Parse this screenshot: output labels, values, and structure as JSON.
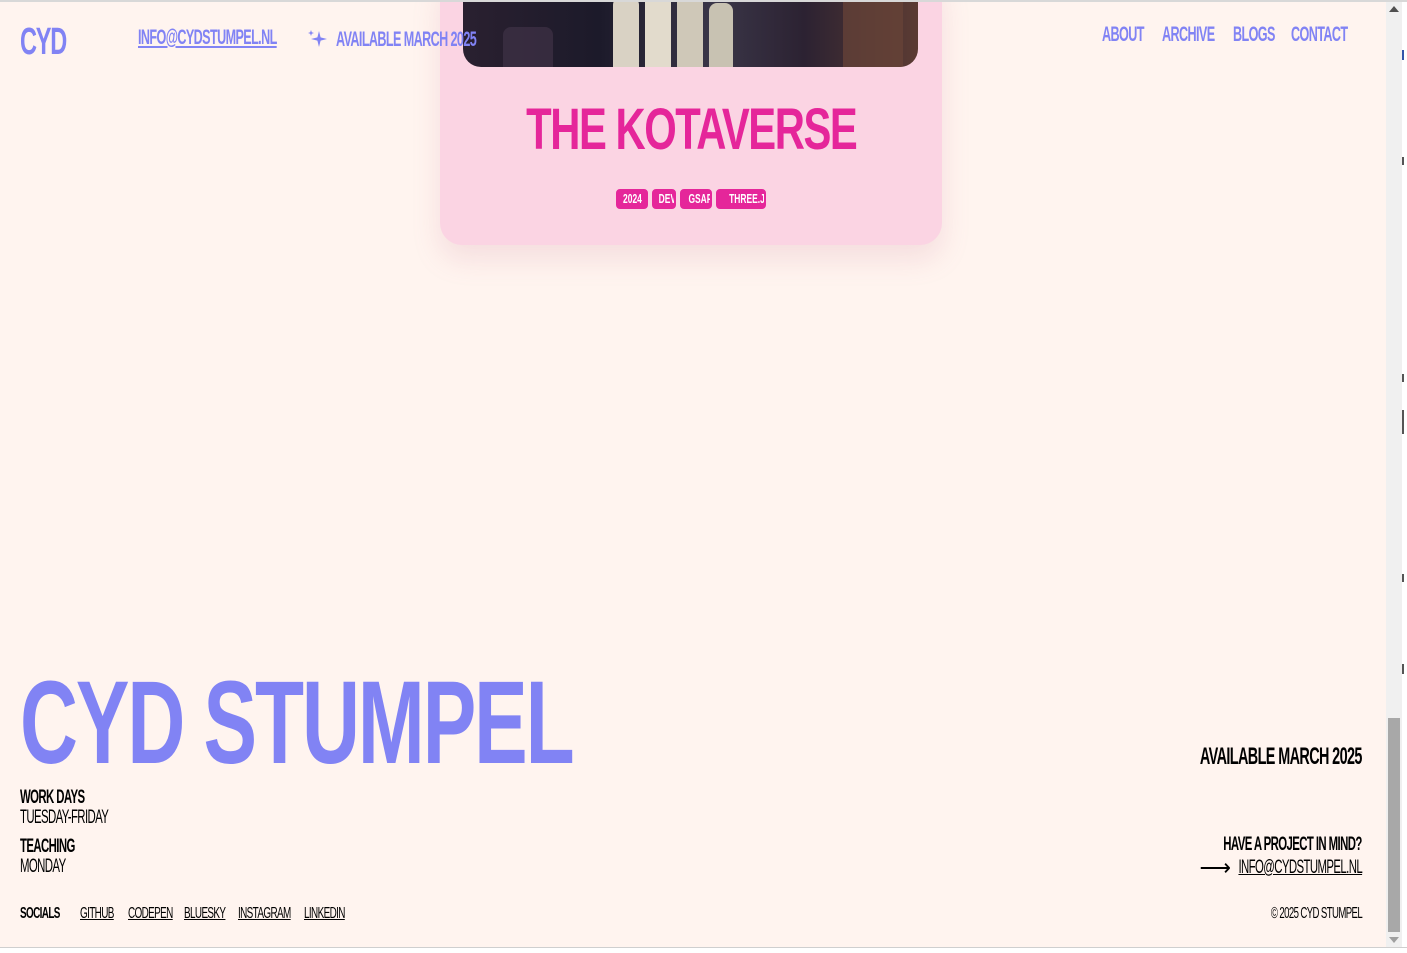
{
  "header": {
    "logo": "CYD",
    "email": "INFO@CYDSTUMPEL.NL",
    "sparkle_icon": "sparkle-icon",
    "availability": "AVAILABLE MARCH 2025",
    "nav": [
      "ABOUT",
      "ARCHIVE",
      "BLOGS",
      "CONTACT"
    ]
  },
  "project_card": {
    "title": "THE KOTAVERSE",
    "tags": [
      "2024",
      "DEV",
      "GSAP",
      "THREE.JS"
    ]
  },
  "footer": {
    "name": "CYD STUMPEL",
    "availability": "AVAILABLE MARCH 2025",
    "work_days_label": "WORK DAYS",
    "work_days_value": "TUESDAY-FRIDAY",
    "teaching_label": "TEACHING",
    "teaching_value": "MONDAY",
    "project_question": "HAVE A PROJECT IN MIND?",
    "arrow_icon": "arrow-right-icon",
    "contact_email": "INFO@CYDSTUMPEL.NL",
    "socials_label": "SOCIALS",
    "socials": [
      "GITHUB",
      "CODEPEN",
      "BLUESKY",
      "INSTAGRAM",
      "LINKEDIN"
    ],
    "copyright": "© 2025 CYD STUMPEL"
  },
  "colors": {
    "background": "#fff4ef",
    "accent_periwinkle": "#8183f4",
    "card_pink": "#fbd4e3",
    "hot_pink": "#e5269a",
    "text": "#000000"
  }
}
